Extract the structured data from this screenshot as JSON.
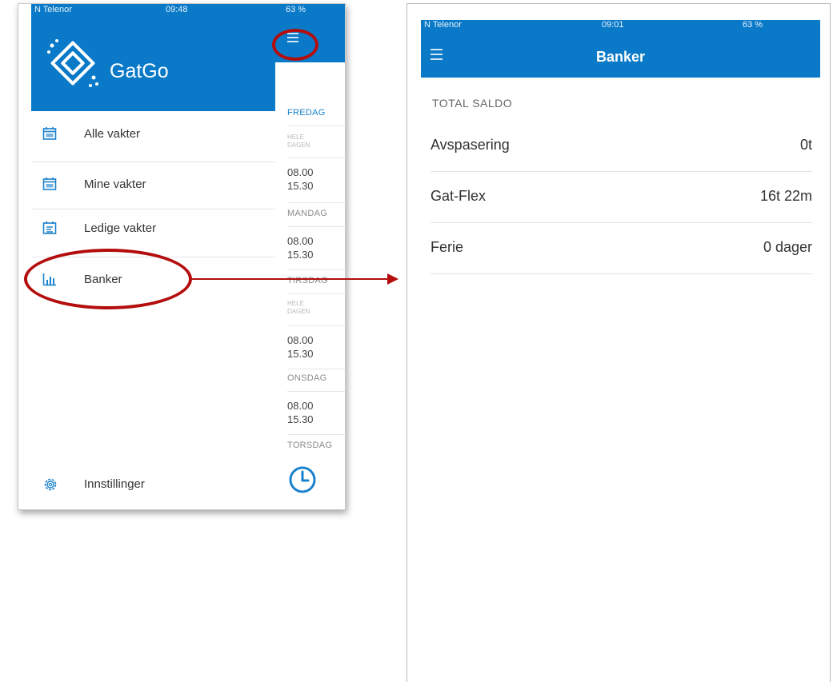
{
  "left_screen": {
    "status": {
      "carrier": "N Telenor",
      "time": "09:48",
      "battery": "63 %"
    },
    "brand": "GatGo",
    "drawer": {
      "items": [
        {
          "label": "Alle vakter",
          "icon": "calendar-grid-icon"
        },
        {
          "label": "Mine vakter",
          "icon": "calendar-grid-icon"
        },
        {
          "label": "Ledige vakter",
          "icon": "calendar-list-icon"
        },
        {
          "label": "Banker",
          "icon": "bar-chart-icon"
        }
      ],
      "settings_label": "Innstillinger"
    },
    "schedule": {
      "days": [
        "FREDAG",
        "MANDAG",
        "TIRSDAG",
        "ONSDAG",
        "TORSDAG"
      ],
      "all_day": "HELE",
      "all_day_2": "DAGEN",
      "start": "08.00",
      "end": "15.30"
    }
  },
  "right_screen": {
    "status": {
      "carrier": "N Telenor",
      "time": "09:01",
      "battery": "63 %"
    },
    "title": "Banker",
    "section_title": "TOTAL SALDO",
    "rows": [
      {
        "label": "Avspasering",
        "value": "0t"
      },
      {
        "label": "Gat-Flex",
        "value": "16t 22m"
      },
      {
        "label": "Ferie",
        "value": "0 dager"
      }
    ]
  },
  "colors": {
    "primary": "#0a7ac8",
    "annotation": "#b40d0d"
  }
}
